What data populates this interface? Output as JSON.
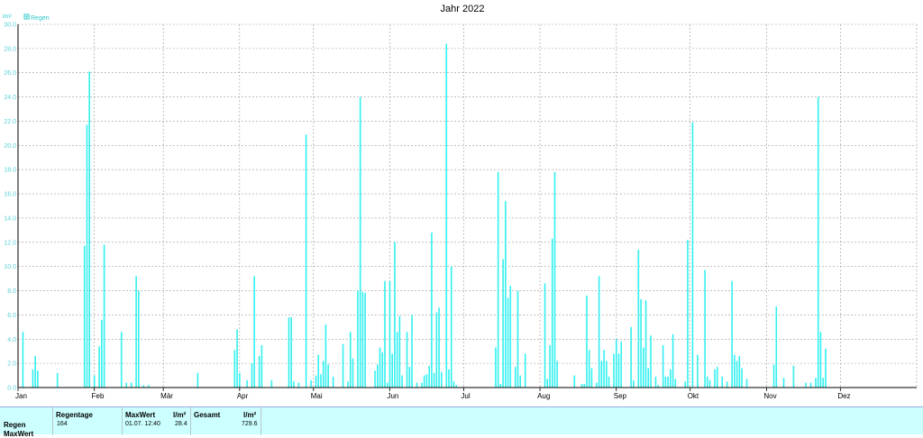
{
  "chart_data": {
    "type": "bar",
    "title": "Jahr 2022",
    "ylabel": "l/m²",
    "ylim": [
      0,
      30
    ],
    "yticks": [
      "0.0",
      "2.0",
      "4.0",
      "6.0",
      "8.0",
      "10.0",
      "12.0",
      "14.0",
      "16.0",
      "18.0",
      "20.0",
      "22.0",
      "24.0",
      "26.0",
      "28.0",
      "30.0"
    ],
    "months": [
      "Jan",
      "Feb",
      "Mär",
      "Apr",
      "Mai",
      "Jun",
      "Jul",
      "Aug",
      "Sep",
      "Okt",
      "Nov",
      "Dez"
    ],
    "grid": true,
    "legend_position": "top-left",
    "series": [
      {
        "name": "Regen",
        "color": "#33f0f0",
        "points": [
          [
            2,
            4.6
          ],
          [
            6,
            1.5
          ],
          [
            7,
            2.6
          ],
          [
            8,
            1.4
          ],
          [
            16,
            1.2
          ],
          [
            27,
            11.7
          ],
          [
            28,
            21.7
          ],
          [
            29,
            26.1
          ],
          [
            31,
            1.0
          ],
          [
            33,
            3.4
          ],
          [
            34,
            5.6
          ],
          [
            35,
            11.8
          ],
          [
            42,
            4.6
          ],
          [
            44,
            0.4
          ],
          [
            46,
            0.4
          ],
          [
            48,
            9.2
          ],
          [
            49,
            8.0
          ],
          [
            51,
            0.2
          ],
          [
            53,
            0.2
          ],
          [
            73,
            1.2
          ],
          [
            88,
            3.1
          ],
          [
            89,
            4.8
          ],
          [
            90,
            1.2
          ],
          [
            93,
            0.6
          ],
          [
            95,
            2.0
          ],
          [
            96,
            9.2
          ],
          [
            98,
            2.6
          ],
          [
            99,
            3.5
          ],
          [
            103,
            0.6
          ],
          [
            110,
            5.8
          ],
          [
            111,
            5.8
          ],
          [
            112,
            0.5
          ],
          [
            114,
            0.4
          ],
          [
            117,
            20.9
          ],
          [
            119,
            0.6
          ],
          [
            121,
            1.0
          ],
          [
            122,
            2.7
          ],
          [
            123,
            1.1
          ],
          [
            124,
            2.2
          ],
          [
            125,
            5.2
          ],
          [
            126,
            1.9
          ],
          [
            128,
            0.9
          ],
          [
            132,
            3.6
          ],
          [
            134,
            0.5
          ],
          [
            135,
            4.6
          ],
          [
            136,
            2.4
          ],
          [
            138,
            8.0
          ],
          [
            139,
            24.0
          ],
          [
            140,
            7.9
          ],
          [
            141,
            7.8
          ],
          [
            145,
            1.4
          ],
          [
            146,
            1.9
          ],
          [
            147,
            3.3
          ],
          [
            148,
            2.9
          ],
          [
            149,
            8.8
          ],
          [
            150,
            0.4
          ],
          [
            151,
            8.8
          ],
          [
            152,
            2.8
          ],
          [
            153,
            12.0
          ],
          [
            154,
            4.6
          ],
          [
            155,
            5.9
          ],
          [
            156,
            1.0
          ],
          [
            158,
            4.6
          ],
          [
            159,
            1.7
          ],
          [
            160,
            6.0
          ],
          [
            162,
            0.4
          ],
          [
            164,
            0.4
          ],
          [
            165,
            1.0
          ],
          [
            166,
            1.1
          ],
          [
            167,
            1.8
          ],
          [
            168,
            12.8
          ],
          [
            169,
            1.2
          ],
          [
            170,
            6.2
          ],
          [
            171,
            6.6
          ],
          [
            172,
            1.3
          ],
          [
            174,
            28.4
          ],
          [
            175,
            1.5
          ],
          [
            176,
            10.0
          ],
          [
            177,
            0.5
          ],
          [
            178,
            0.2
          ],
          [
            194,
            3.3
          ],
          [
            195,
            17.8
          ],
          [
            196,
            0.3
          ],
          [
            197,
            10.6
          ],
          [
            198,
            15.4
          ],
          [
            199,
            7.4
          ],
          [
            200,
            8.4
          ],
          [
            202,
            1.7
          ],
          [
            203,
            8.0
          ],
          [
            204,
            1.0
          ],
          [
            206,
            2.8
          ],
          [
            214,
            8.6
          ],
          [
            215,
            0.7
          ],
          [
            216,
            3.5
          ],
          [
            217,
            12.3
          ],
          [
            218,
            17.8
          ],
          [
            219,
            2.2
          ],
          [
            226,
            1.0
          ],
          [
            229,
            0.3
          ],
          [
            230,
            0.3
          ],
          [
            231,
            7.6
          ],
          [
            232,
            3.1
          ],
          [
            233,
            1.6
          ],
          [
            235,
            0.4
          ],
          [
            236,
            9.2
          ],
          [
            237,
            2.2
          ],
          [
            238,
            3.1
          ],
          [
            239,
            2.2
          ],
          [
            240,
            0.9
          ],
          [
            242,
            2.8
          ],
          [
            243,
            4.0
          ],
          [
            244,
            2.8
          ],
          [
            245,
            3.8
          ],
          [
            249,
            5.0
          ],
          [
            250,
            0.6
          ],
          [
            252,
            11.4
          ],
          [
            253,
            7.3
          ],
          [
            254,
            3.3
          ],
          [
            255,
            7.2
          ],
          [
            256,
            1.6
          ],
          [
            257,
            4.3
          ],
          [
            259,
            0.9
          ],
          [
            260,
            0.2
          ],
          [
            262,
            3.5
          ],
          [
            263,
            0.9
          ],
          [
            264,
            0.9
          ],
          [
            265,
            1.5
          ],
          [
            266,
            4.4
          ],
          [
            267,
            0.7
          ],
          [
            271,
            0.5
          ],
          [
            272,
            12.2
          ],
          [
            274,
            21.9
          ],
          [
            276,
            2.7
          ],
          [
            279,
            9.7
          ],
          [
            280,
            0.9
          ],
          [
            281,
            0.6
          ],
          [
            283,
            1.5
          ],
          [
            284,
            1.7
          ],
          [
            286,
            0.9
          ],
          [
            288,
            0.5
          ],
          [
            290,
            8.8
          ],
          [
            291,
            2.7
          ],
          [
            292,
            2.2
          ],
          [
            293,
            2.6
          ],
          [
            294,
            1.6
          ],
          [
            296,
            0.7
          ],
          [
            307,
            1.9
          ],
          [
            308,
            6.7
          ],
          [
            311,
            0.8
          ],
          [
            315,
            1.8
          ],
          [
            320,
            0.4
          ],
          [
            322,
            0.4
          ],
          [
            324,
            0.8
          ],
          [
            325,
            24.0
          ],
          [
            326,
            4.6
          ],
          [
            327,
            0.8
          ],
          [
            328,
            3.2
          ]
        ]
      }
    ]
  },
  "summary": {
    "headers": {
      "regentage": "Regentage",
      "maxwert": "MaxWert",
      "maxwert_unit": "l/m²",
      "gesamt": "Gesamt",
      "gesamt_unit": "l/m²"
    },
    "rows": [
      {
        "label": "Regen",
        "regentage": "164",
        "maxwert_date": "01.07. 12:40",
        "maxwert_value": "28.4",
        "gesamt": "729.6"
      },
      {
        "label": "MaxWert"
      }
    ]
  }
}
